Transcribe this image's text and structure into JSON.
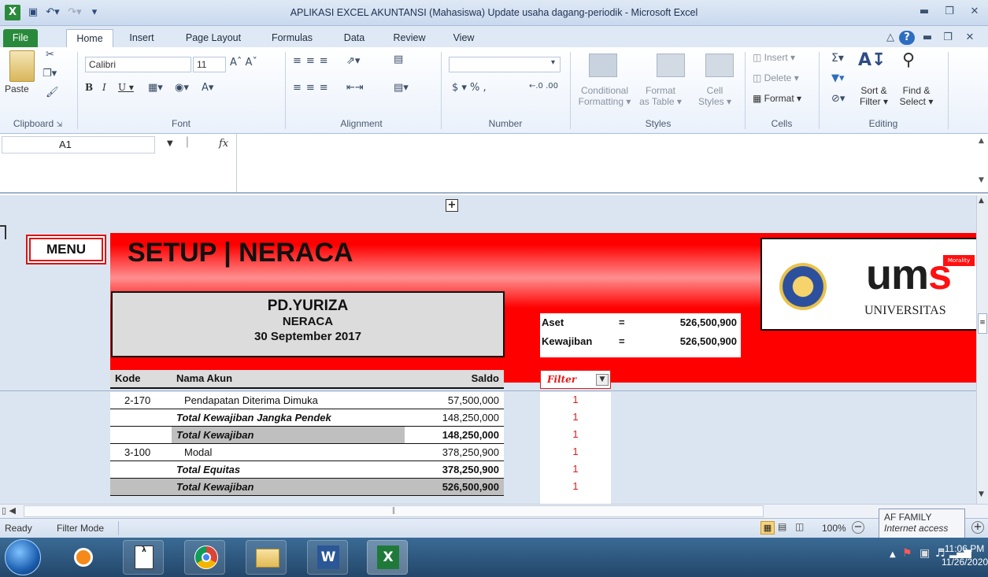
{
  "window": {
    "title": "APLIKASI EXCEL AKUNTANSI (Mahasiswa) Update usaha dagang-periodik  -  Microsoft Excel"
  },
  "tabs": [
    "File",
    "Home",
    "Insert",
    "Page Layout",
    "Formulas",
    "Data",
    "Review",
    "View"
  ],
  "ribbon": {
    "clipboard": {
      "paste": "Paste",
      "label": "Clipboard"
    },
    "font": {
      "name": "Calibri",
      "size": "11",
      "label": "Font"
    },
    "alignment": {
      "label": "Alignment"
    },
    "number": {
      "format": "",
      "label": "Number"
    },
    "styles": {
      "conditional": "Conditional",
      "formatting": "Formatting",
      "format": "Format",
      "as_table": "as Table",
      "cell": "Cell",
      "styles_word": "Styles",
      "label": "Styles"
    },
    "cells": {
      "insert": "Insert",
      "delete": "Delete",
      "format": "Format",
      "label": "Cells"
    },
    "editing": {
      "sort": "Sort &",
      "filter": "Filter",
      "find": "Find &",
      "select": "Select",
      "label": "Editing"
    }
  },
  "formula_bar": {
    "name_box": "A1",
    "fx": "fx",
    "formula": ""
  },
  "sheet": {
    "menu_button": "MENU",
    "banner_title": "SETUP | NERACA",
    "company": "PD.YURIZA",
    "report": "NERACA",
    "date": "30 September 2017",
    "summary": [
      {
        "label": "Aset",
        "eq": "=",
        "value": "526,500,900"
      },
      {
        "label": "Kewajiban",
        "eq": "=",
        "value": "526,500,900"
      }
    ],
    "logo_text": "ums",
    "logo_sub": "UNIVERSITAS",
    "logo_tag": "Morality",
    "headers": {
      "kode": "Kode",
      "nama": "Nama Akun",
      "saldo": "Saldo",
      "filter": "Filter"
    },
    "rows": [
      {
        "kode": "2-170",
        "nama": "Pendapatan Diterima Dimuka",
        "saldo": "57,500,000",
        "filter": "1"
      },
      {
        "kode": "",
        "nama": "Total Kewajiban Jangka Pendek",
        "saldo": "148,250,000",
        "filter": "1"
      },
      {
        "kode": "",
        "nama": "Total Kewajiban",
        "saldo": "148,250,000",
        "filter": "1"
      },
      {
        "kode": "3-100",
        "nama": "Modal",
        "saldo": "378,250,900",
        "filter": "1"
      },
      {
        "kode": "",
        "nama": "Total Equitas",
        "saldo": "378,250,900",
        "filter": "1"
      },
      {
        "kode": "",
        "nama": "Total Kewajiban",
        "saldo": "526,500,900",
        "filter": "1"
      }
    ]
  },
  "status": {
    "ready": "Ready",
    "mode": "Filter Mode",
    "zoom": "100%"
  },
  "tooltip": {
    "title": "AF FAMILY",
    "sub": "Internet access"
  },
  "clock": {
    "time": "11:06 PM",
    "date": "11/26/2020"
  },
  "colors": {
    "banner_red": "#ff0000",
    "file_tab": "#2a8a3b",
    "filter_red": "#e11919",
    "gray_row": "#bfbfbf"
  }
}
